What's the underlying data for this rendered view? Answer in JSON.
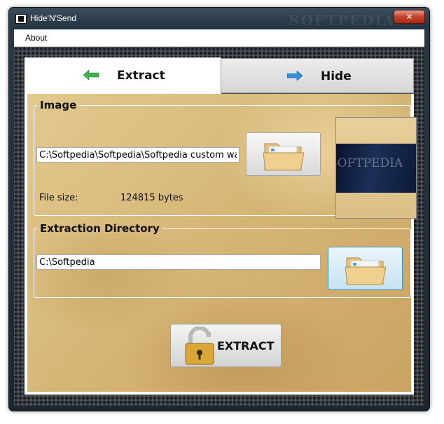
{
  "window": {
    "title": "Hide'N'Send",
    "watermark": "SOFTPEDIA",
    "close_glyph": "✕"
  },
  "menu": {
    "items": [
      {
        "label": "About"
      }
    ]
  },
  "tabs": [
    {
      "label": "Extract",
      "icon": "arrow-left-icon",
      "selected": true
    },
    {
      "label": "Hide",
      "icon": "arrow-right-icon",
      "selected": false
    }
  ],
  "image_group": {
    "legend": "Image",
    "path_value": "C:\\Softpedia\\Softpedia\\Softpedia custom wallpaper.png",
    "file_size_label": "File size:",
    "file_size_value": "124815 bytes",
    "browse_icon": "folder-icon",
    "preview_watermark": "SOFTPEDIA"
  },
  "extraction_group": {
    "legend": "Extraction Directory",
    "path_value": "C:\\Softpedia",
    "browse_icon": "folder-icon"
  },
  "extract_button": {
    "label": "EXTRACT",
    "icon": "padlock-icon"
  },
  "colors": {
    "close": "#c2422a",
    "active_button": "#3d8ec3",
    "extract_arrow": "#3cb34a",
    "hide_arrow": "#2f8fd8"
  }
}
